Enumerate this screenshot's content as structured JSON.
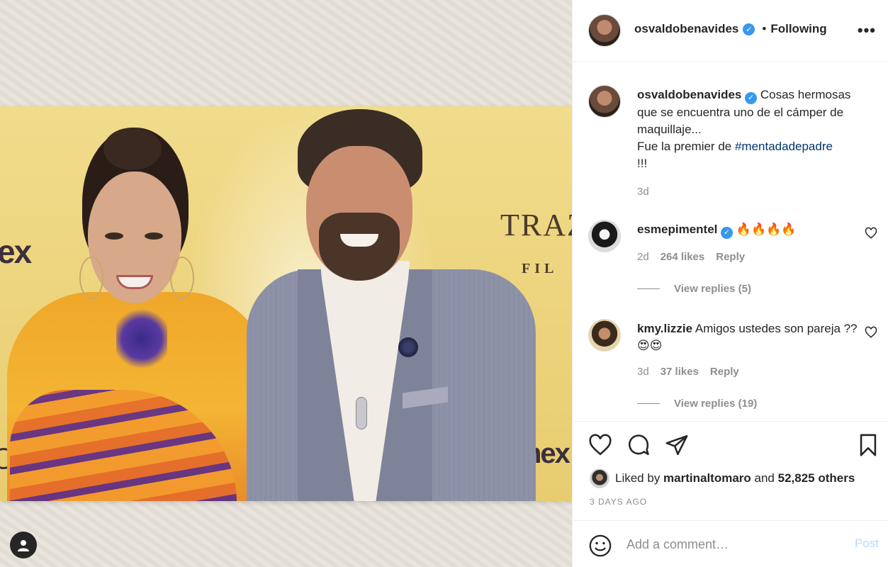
{
  "post": {
    "author": "osvaldobenavides",
    "follow_separator": "•",
    "follow_status": "Following",
    "more_label": "•••"
  },
  "photo": {
    "brand_left": "ex",
    "brand_right": "TRAZI",
    "brand_right_sub": "FIL",
    "brand_bottom_right": "nex"
  },
  "caption": {
    "username": "osvaldobenavides",
    "text_part1": "Cosas hermosas que se encuentra uno de el cámper de maquillaje...",
    "text_part2": "Fue la premier de ",
    "hashtag": "#mentadadepadre",
    "text_part3": "!!!",
    "age": "3d"
  },
  "comments": [
    {
      "username": "esmepimentel",
      "text": "🔥🔥🔥🔥",
      "age": "2d",
      "likes": "264 likes",
      "reply_label": "Reply",
      "view_replies": "View replies (5)"
    },
    {
      "username": "kmy.lizzie",
      "text": "Amigos ustedes son pareja ??😍😍",
      "age": "3d",
      "likes": "37 likes",
      "reply_label": "Reply",
      "view_replies": "View replies (19)"
    }
  ],
  "likes": {
    "prefix": "Liked by ",
    "user": "martinaltomaro",
    "middle": " and ",
    "count": "52,825 others"
  },
  "date": "3 DAYS AGO",
  "add_comment": {
    "placeholder": "Add a comment…",
    "post_label": "Post"
  },
  "colors": {
    "verified": "#3897f0",
    "hashtag": "#00376b",
    "muted": "#8e8e8e",
    "post_disabled": "#b3dbff"
  },
  "icons": [
    "heart-icon",
    "comment-icon",
    "share-icon",
    "bookmark-icon",
    "emoji-icon",
    "user-icon",
    "verified-badge-icon",
    "more-options-icon"
  ]
}
